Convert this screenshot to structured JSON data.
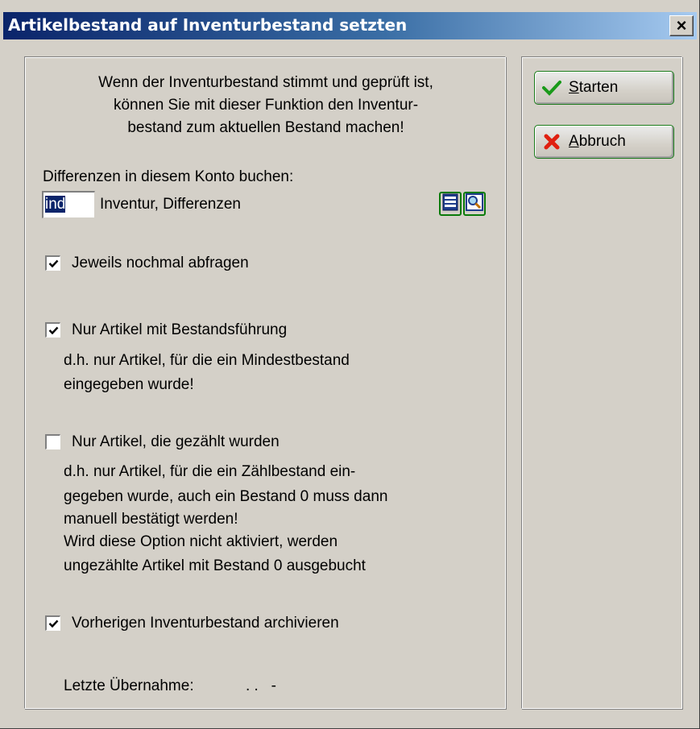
{
  "window": {
    "title": "Artikelbestand auf Inventurbestand setzten",
    "close_symbol": "×"
  },
  "intro": {
    "line1": "Wenn der Inventurbestand stimmt und geprüft ist,",
    "line2": "können Sie mit dieser Funktion den Inventur-",
    "line3": "bestand zum aktuellen Bestand machen!"
  },
  "konto": {
    "label": "Differenzen in diesem Konto buchen:",
    "value": "ind",
    "description": "Inventur, Differenzen",
    "list_icon": "list-icon",
    "search_icon": "magnifier-icon"
  },
  "options": {
    "jeweils": {
      "label": "Jeweils nochmal abfragen",
      "checked": true
    },
    "bestandsfuehrung": {
      "label": "Nur Artikel mit Bestandsführung",
      "checked": true,
      "hint1": "d.h. nur Artikel, für die ein Mindestbestand",
      "hint2": "eingegeben wurde!"
    },
    "gezaehlt": {
      "label": "Nur Artikel, die gezählt wurden",
      "checked": false,
      "hint1": "d.h. nur Artikel, für die ein Zählbestand ein-",
      "hint2": "gegeben wurde, auch ein Bestand 0 muss dann",
      "hint3": "manuell bestätigt werden!",
      "hint4": "Wird diese Option nicht aktiviert, werden",
      "hint5": "ungezählte Artikel mit Bestand 0 ausgebucht"
    },
    "archivieren": {
      "label": "Vorherigen Inventurbestand archivieren",
      "checked": true
    }
  },
  "letzte": {
    "label": "Letzte Übernahme:",
    "value": ". .   -"
  },
  "buttons": {
    "start": {
      "mnemonic": "S",
      "rest": "tarten",
      "icon": "checkmark-icon",
      "icon_color": "#1a9a1a"
    },
    "abbruch": {
      "mnemonic": "A",
      "rest": "bbruch",
      "icon": "red-x-icon",
      "icon_color": "#e02010"
    }
  },
  "colors": {
    "face": "#d4d0c8",
    "title_dark": "#0a246a",
    "title_light": "#a6caf0",
    "button_border": "#1a7a1a"
  }
}
